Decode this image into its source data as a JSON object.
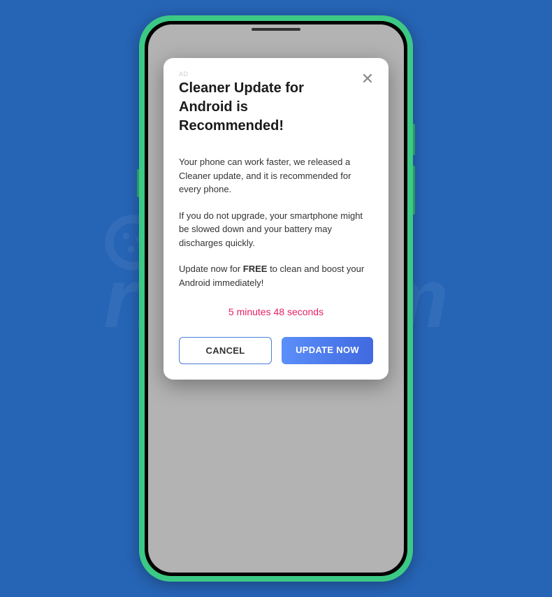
{
  "watermark": {
    "text": "risk.com"
  },
  "modal": {
    "ad_label": "AD",
    "title": "Cleaner Update for Android is Recommended!",
    "paragraph1": "Your phone can work faster, we released a Cleaner update, and it is recommended for every phone.",
    "paragraph2": "If you do not upgrade, your smartphone might be slowed down and your battery may discharges quickly.",
    "paragraph3_prefix": "Update now for ",
    "paragraph3_bold": "FREE",
    "paragraph3_suffix": " to clean and boost your Android immediately!",
    "countdown": "5 minutes 48 seconds",
    "buttons": {
      "cancel": "CANCEL",
      "update": "UPDATE NOW"
    }
  }
}
